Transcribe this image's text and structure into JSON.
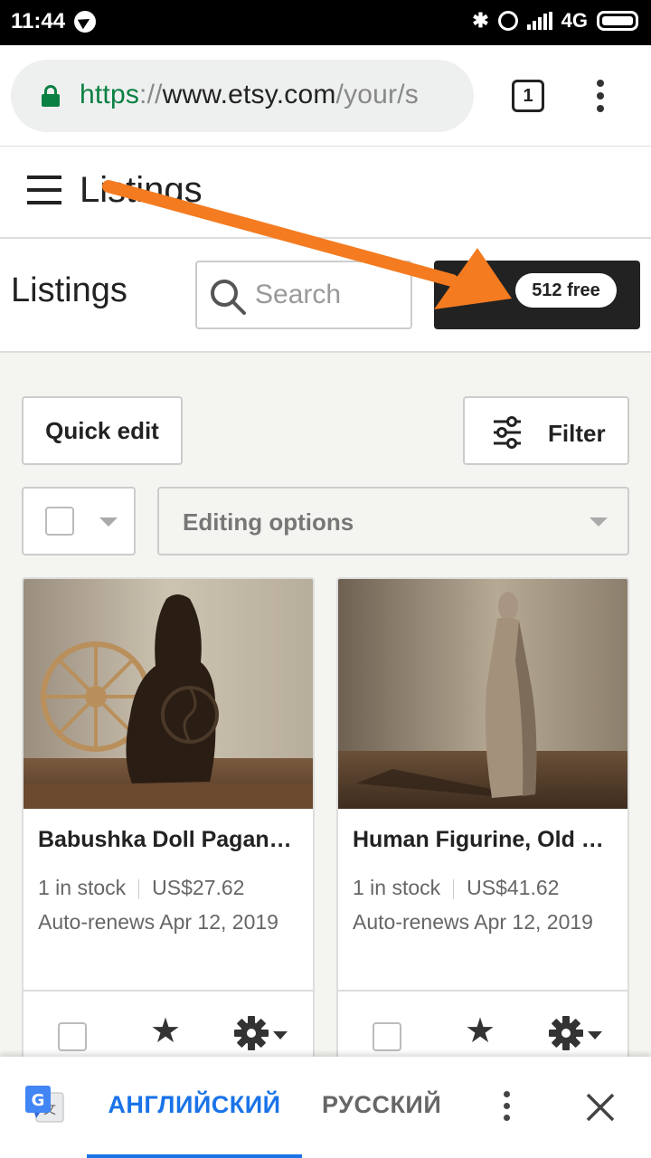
{
  "status_bar": {
    "time": "11:44",
    "network": "4G"
  },
  "browser": {
    "url_scheme": "https",
    "url_sep": "://",
    "url_host": "www.etsy.com",
    "url_path": "/your/s",
    "tab_count": "1"
  },
  "app_header": {
    "title": "Listings"
  },
  "toolbar": {
    "heading": "Listings",
    "search_placeholder": "Search",
    "free_badge": "512 free",
    "add_symbol": "+"
  },
  "controls": {
    "quick_edit": "Quick edit",
    "filter": "Filter",
    "editing_options": "Editing options"
  },
  "listings": [
    {
      "title": "Babushka Doll Pagan…",
      "stock": "1 in stock",
      "price": "US$27.62",
      "renewal": "Auto-renews Apr 12, 2019"
    },
    {
      "title": "Human Figurine, Old …",
      "stock": "1 in stock",
      "price": "US$41.62",
      "renewal": "Auto-renews Apr 12, 2019"
    }
  ],
  "translate_bar": {
    "source_lang": "АНГЛИЙСКИЙ",
    "target_lang": "РУССКИЙ"
  },
  "colors": {
    "accent_green": "#0b8043",
    "translate_blue": "#1a73e8",
    "annotation_orange": "#f47b20",
    "dark_button": "#222222"
  },
  "icons": [
    "telegram-icon",
    "bluetooth-icon",
    "alarm-icon",
    "signal-icon",
    "battery-icon",
    "lock-icon",
    "tabs-icon",
    "menu-icon",
    "hamburger-icon",
    "search-icon",
    "filter-icon",
    "chevron-down-icon",
    "star-icon",
    "gear-icon",
    "google-translate-icon",
    "close-icon"
  ]
}
